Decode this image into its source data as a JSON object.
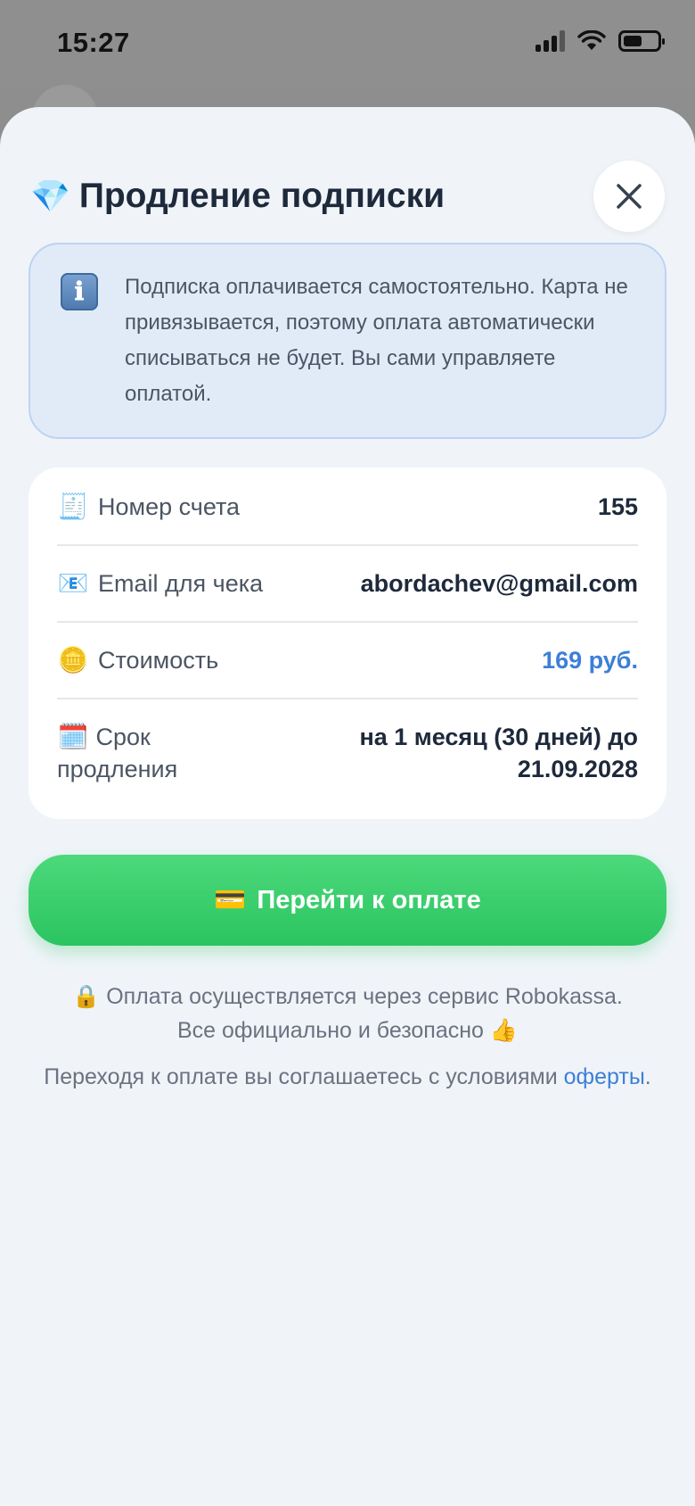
{
  "status_bar": {
    "time": "15:27"
  },
  "dialog": {
    "title_icon": "💎",
    "title": "Продление подписки",
    "close_icon": "close-icon"
  },
  "info": {
    "icon": "ℹ",
    "text": "Подписка оплачивается самостоятельно. Карта не привязывается, поэтому оплата автоматически списываться не будет. Вы сами управляете оплатой."
  },
  "details": {
    "rows": [
      {
        "icon": "🧾",
        "label": "Номер счета",
        "value": "155"
      },
      {
        "icon": "📧",
        "label": "Email для чека",
        "value": "abordachev@gmail.com"
      },
      {
        "icon": "🪙",
        "label": "Стоимость",
        "value": "169 руб."
      },
      {
        "icon": "🗓️",
        "label": "Срок продления",
        "value": "на 1 месяц (30 дней) до 21.09.2028"
      }
    ]
  },
  "pay_button": {
    "icon": "💳",
    "label": "Перейти к оплате"
  },
  "footer": {
    "lock_icon": "🔒",
    "secure_line1": "Оплата осуществляется через сервис Robokassa.",
    "secure_line2": "Все официально и безопасно",
    "thumbs_icon": "👍",
    "terms_text": "Переходя к оплате вы соглашаетесь с условиями",
    "terms_link": "оферты",
    "terms_end": "."
  },
  "colors": {
    "accent_green": "#2bc461",
    "link_blue": "#3d7fd8",
    "info_bg": "#e1ebf8"
  }
}
